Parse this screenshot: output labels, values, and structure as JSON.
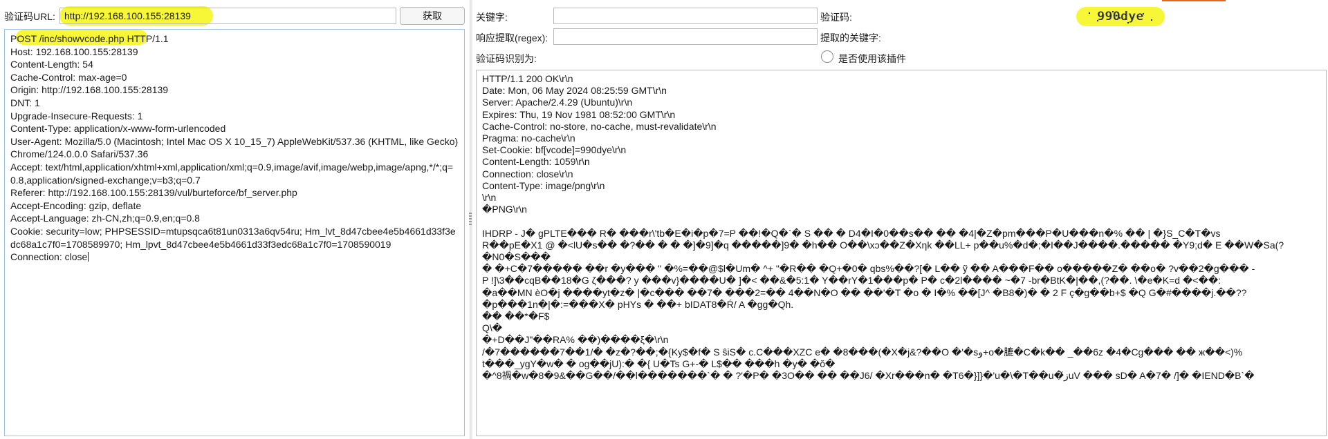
{
  "left": {
    "url_label": "验证码URL:",
    "url_value": "http://192.168.100.155:28139",
    "fetch_button": "获取",
    "request_lines": [
      "POST /inc/showvcode.php HTTP/1.1",
      "Host: 192.168.100.155:28139",
      "Content-Length: 54",
      "Cache-Control: max-age=0",
      "Origin: http://192.168.100.155:28139",
      "DNT: 1",
      "Upgrade-Insecure-Requests: 1",
      "Content-Type: application/x-www-form-urlencoded",
      "User-Agent: Mozilla/5.0 (Macintosh; Intel Mac OS X 10_15_7) AppleWebKit/537.36 (KHTML, like Gecko) Chrome/124.0.0.0 Safari/537.36",
      "Accept: text/html,application/xhtml+xml,application/xml;q=0.9,image/avif,image/webp,image/apng,*/*;q=0.8,application/signed-exchange;v=b3;q=0.7",
      "Referer: http://192.168.100.155:28139/vul/burteforce/bf_server.php",
      "Accept-Encoding: gzip, deflate",
      "Accept-Language: zh-CN,zh;q=0.9,en;q=0.8",
      "Cookie: security=low; PHPSESSID=mtupsqca6t81un0313a6qv54ru; Hm_lvt_8d47cbee4e5b4661d33f3edc68a1c7f0=1708589970; Hm_lpvt_8d47cbee4e5b4661d33f3edc68a1c7f0=1708590019",
      "Connection: close"
    ]
  },
  "right": {
    "keyword_label": "关键字:",
    "keyword_value": "",
    "captcha_label": "验证码:",
    "captcha_image_text": "990dye",
    "regex_label": "响应提取(regex):",
    "regex_value": "",
    "extracted_keyword_label": "提取的关键字:",
    "recognized_label": "验证码识别为:",
    "use_plugin_label": "是否使用该插件",
    "response_lines": [
      "HTTP/1.1 200 OK\\r\\n",
      "Date: Mon, 06 May 2024 08:25:59 GMT\\r\\n",
      "Server: Apache/2.4.29 (Ubuntu)\\r\\n",
      "Expires: Thu, 19 Nov 1981 08:52:00 GMT\\r\\n",
      "Cache-Control: no-store, no-cache, must-revalidate\\r\\n",
      "Pragma: no-cache\\r\\n",
      "Set-Cookie: bf[vcode]=990dye\\r\\n",
      "Content-Length: 1059\\r\\n",
      "Connection: close\\r\\n",
      "Content-Type: image/png\\r\\n",
      "\\r\\n",
      "�PNG\\r\\n",
      "",
      " IHDRP  - J� gPLTE��� R� ���r\\'tb�E�i�p�7=P  ��!�Q�`� S �� � D4�I�0��s�� �� �4|�Z�pm���P�U���n�% �� | �}S_C�T�vs",
      "R��pE�X1 @ �<lU�s�� �?�� � � �]�9]�q �����]9� �h�� O��\\xɔ��Z�Xηk ��LL+ p��u%�d�;�I��J����.����� �Y9;d� E ��W�Sa(?",
      "�N0�S���",
      "� �+C�7����� ��r �y��� \" �%=��@$l�Um� ^+ \"�R�� �Q+�0� qbs%��?[� L�� ỹ �� A���F�� o�����Z� ��o� ?v��2�g��� -",
      "P !]\\3��cqB��18�G ζ���? y ���v}����U� ]�< ��&�5:1� Y��rY�1���p� P� c�2l����           ~�7 -br�BtK�|��,(?��. \\�e�K=d �<��:",
      "�a��MN èO�j ����yt�z� |�c��� ��7�  ���2=�� 4��N�O       �� ��'�T �o � I�% ��[J^ �B8�)� �  2 F ç�g��b+$ �Q G�#����j.��??",
      "�p���1n�|�:=���X�                  pHYs � ��+  bIDAT8�Ŕ/ A �gg�Qh.",
      "�� ��*�F$",
      " Q\\�",
      "�+D��J\"��RA% ��)����ξ�\\r\\n",
      "/�7������7��1/� �z�?��;�{Ky$�f� S ŝiS� c.C���XZC e� �8���(�X�j&?��O �'�sو+o�膔�C�k�� _��6z �4�Cg��� �� ж��<)%",
      "t���_ygY�w�  � og��jU):� �{ U�Ts G+-� L$�� ���h �y� �ŏ�",
      "�^8禍�w�8�9&��G��/��l�������`� � ?'�P� �3O�� �� ��J6/ �Xr���n� �T6�}]}�'u�\\�T��u�ز̌uV  ��� sD� A�7� /]� �IEND�B`�"
    ]
  },
  "colors": {
    "highlight": "#f7f737",
    "left_panel_border": "#9ec3e6",
    "accent_top": "#e8651c"
  }
}
